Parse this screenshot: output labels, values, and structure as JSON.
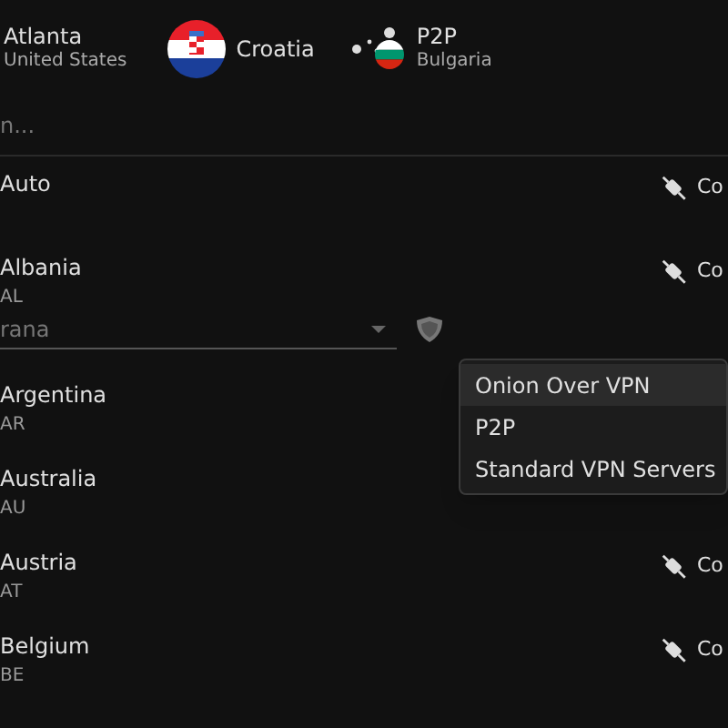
{
  "recent_connections": [
    {
      "kind": "city",
      "title": "Atlanta",
      "subtitle": "United States"
    },
    {
      "kind": "flag",
      "title": "Croatia"
    },
    {
      "kind": "p2p",
      "title": "P2P",
      "subtitle": "Bulgaria"
    }
  ],
  "search": {
    "placeholder": "n..."
  },
  "countries": [
    {
      "name": "Auto",
      "connect": "Co"
    },
    {
      "name": "Albania",
      "code": "AL",
      "connect": "Co",
      "city_select": {
        "value": "rana"
      }
    },
    {
      "name": "Argentina",
      "code": "AR"
    },
    {
      "name": "Australia",
      "code": "AU"
    },
    {
      "name": "Austria",
      "code": "AT",
      "connect": "Co"
    },
    {
      "name": "Belgium",
      "code": "BE",
      "connect": "Co"
    }
  ],
  "server_type_menu": [
    {
      "label": "Onion Over VPN",
      "selected": true
    },
    {
      "label": "P2P",
      "selected": false
    },
    {
      "label": "Standard VPN Servers",
      "selected": false
    }
  ]
}
